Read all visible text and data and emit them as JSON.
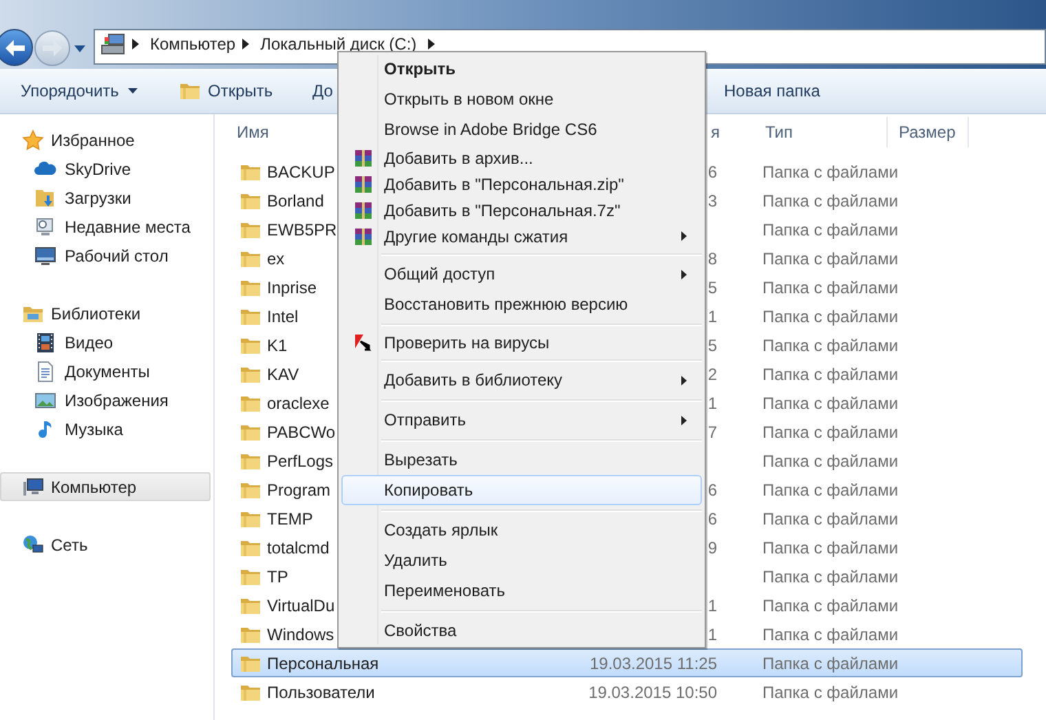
{
  "nav": {
    "back_enabled": true,
    "forward_enabled": false
  },
  "address": {
    "crumbs": [
      "Компьютер",
      "Локальный диск (C:)"
    ]
  },
  "toolbar": [
    {
      "label": "Упорядочить",
      "kind": "dropdown"
    },
    {
      "label": "Открыть",
      "kind": "open"
    },
    {
      "label": "До",
      "kind": "plain"
    },
    {
      "label": "Новая папка",
      "kind": "plain"
    }
  ],
  "sidebar": {
    "groups": [
      {
        "label": "Избранное",
        "selected": false,
        "children": [
          {
            "label": "SkyDrive",
            "selected": false
          },
          {
            "label": "Загрузки",
            "selected": false
          },
          {
            "label": "Недавние места",
            "selected": false
          },
          {
            "label": "Рабочий стол",
            "selected": false
          }
        ]
      },
      {
        "label": "Библиотеки",
        "selected": false,
        "children": [
          {
            "label": "Видео",
            "selected": false
          },
          {
            "label": "Документы",
            "selected": false
          },
          {
            "label": "Изображения",
            "selected": false
          },
          {
            "label": "Музыка",
            "selected": false
          }
        ]
      },
      {
        "label": "Компьютер",
        "selected": true
      },
      {
        "label": "Сеть",
        "selected": false
      }
    ]
  },
  "file_list": {
    "columns": [
      {
        "label": "Имя"
      },
      {
        "label": "я"
      },
      {
        "label": "Тип"
      },
      {
        "label": "Размер"
      }
    ],
    "rows": [
      {
        "name": "BACKUP",
        "date": "6",
        "type": "Папка с файлами",
        "selected": false
      },
      {
        "name": "Borland",
        "date": "3",
        "type": "Папка с файлами",
        "selected": false
      },
      {
        "name": "EWB5PR",
        "type": "Папка с файлами",
        "selected": false
      },
      {
        "name": "ex",
        "date": "8",
        "type": "Папка с файлами",
        "selected": false
      },
      {
        "name": "Inprise",
        "date": "5",
        "type": "Папка с файлами",
        "selected": false
      },
      {
        "name": "Intel",
        "date": "1",
        "type": "Папка с файлами",
        "selected": false
      },
      {
        "name": "K1",
        "date": "5",
        "type": "Папка с файлами",
        "selected": false
      },
      {
        "name": "KAV",
        "date": "2",
        "type": "Папка с файлами",
        "selected": false
      },
      {
        "name": "oraclexe",
        "date": "1",
        "type": "Папка с файлами",
        "selected": false
      },
      {
        "name": "PABCWo",
        "date": "7",
        "type": "Папка с файлами",
        "selected": false
      },
      {
        "name": "PerfLogs",
        "type": "Папка с файлами",
        "selected": false
      },
      {
        "name": "Program",
        "date": "6",
        "type": "Папка с файлами",
        "selected": false
      },
      {
        "name": "TEMP",
        "date": "6",
        "type": "Папка с файлами",
        "selected": false
      },
      {
        "name": "totalcmd",
        "date": "9",
        "type": "Папка с файлами",
        "selected": false
      },
      {
        "name": "TP",
        "type": "Папка с файлами",
        "selected": false
      },
      {
        "name": "VirtualDu",
        "date": "1",
        "type": "Папка с файлами",
        "selected": false
      },
      {
        "name": "Windows",
        "date": "1",
        "type": "Папка с файлами",
        "selected": false
      },
      {
        "name": "Персональная",
        "date": "19.03.2015 11:25",
        "type": "Папка с файлами",
        "selected": true
      },
      {
        "name": "Пользователи",
        "date": "19.03.2015 10:50",
        "type": "Папка с файлами",
        "selected": false
      }
    ]
  },
  "context_menu": {
    "items": [
      {
        "kind": "plain",
        "label": "Открыть",
        "bold": true,
        "highlighted": false,
        "submenu": false
      },
      {
        "kind": "plain",
        "label": "Открыть в новом окне",
        "bold": false,
        "highlighted": false,
        "submenu": false
      },
      {
        "kind": "plain",
        "label": "Browse in Adobe Bridge CS6",
        "bold": false,
        "highlighted": false,
        "submenu": false
      },
      {
        "kind": "archive",
        "label": "Добавить в архив...",
        "bold": false,
        "highlighted": false,
        "submenu": false
      },
      {
        "kind": "archive",
        "label": "Добавить в \"Персональная.zip\"",
        "bold": false,
        "highlighted": false,
        "submenu": false
      },
      {
        "kind": "archive",
        "label": "Добавить в \"Персональная.7z\"",
        "bold": false,
        "highlighted": false,
        "submenu": false
      },
      {
        "kind": "archive",
        "label": "Другие команды сжатия",
        "bold": false,
        "highlighted": false,
        "submenu": true
      },
      {
        "kind": "separator"
      },
      {
        "kind": "plain",
        "label": "Общий доступ",
        "bold": false,
        "highlighted": false,
        "submenu": true
      },
      {
        "kind": "plain",
        "label": "Восстановить прежнюю версию",
        "bold": false,
        "highlighted": false,
        "submenu": false
      },
      {
        "kind": "separator"
      },
      {
        "kind": "antivirus",
        "label": "Проверить на вирусы",
        "bold": false,
        "highlighted": false,
        "submenu": false
      },
      {
        "kind": "separator"
      },
      {
        "kind": "plain",
        "label": "Добавить в библиотеку",
        "bold": false,
        "highlighted": false,
        "submenu": true
      },
      {
        "kind": "separator"
      },
      {
        "kind": "plain",
        "label": "Отправить",
        "bold": false,
        "highlighted": false,
        "submenu": true
      },
      {
        "kind": "separator"
      },
      {
        "kind": "plain",
        "label": "Вырезать",
        "bold": false,
        "highlighted": false,
        "submenu": false
      },
      {
        "kind": "plain",
        "label": "Копировать",
        "bold": false,
        "highlighted": true,
        "submenu": false
      },
      {
        "kind": "separator"
      },
      {
        "kind": "plain",
        "label": "Создать ярлык",
        "bold": false,
        "highlighted": false,
        "submenu": false
      },
      {
        "kind": "plain",
        "label": "Удалить",
        "bold": false,
        "highlighted": false,
        "submenu": false
      },
      {
        "kind": "plain",
        "label": "Переименовать",
        "bold": false,
        "highlighted": false,
        "submenu": false
      },
      {
        "kind": "separator"
      },
      {
        "kind": "plain",
        "label": "Свойства",
        "bold": false,
        "highlighted": false,
        "submenu": false
      }
    ]
  }
}
